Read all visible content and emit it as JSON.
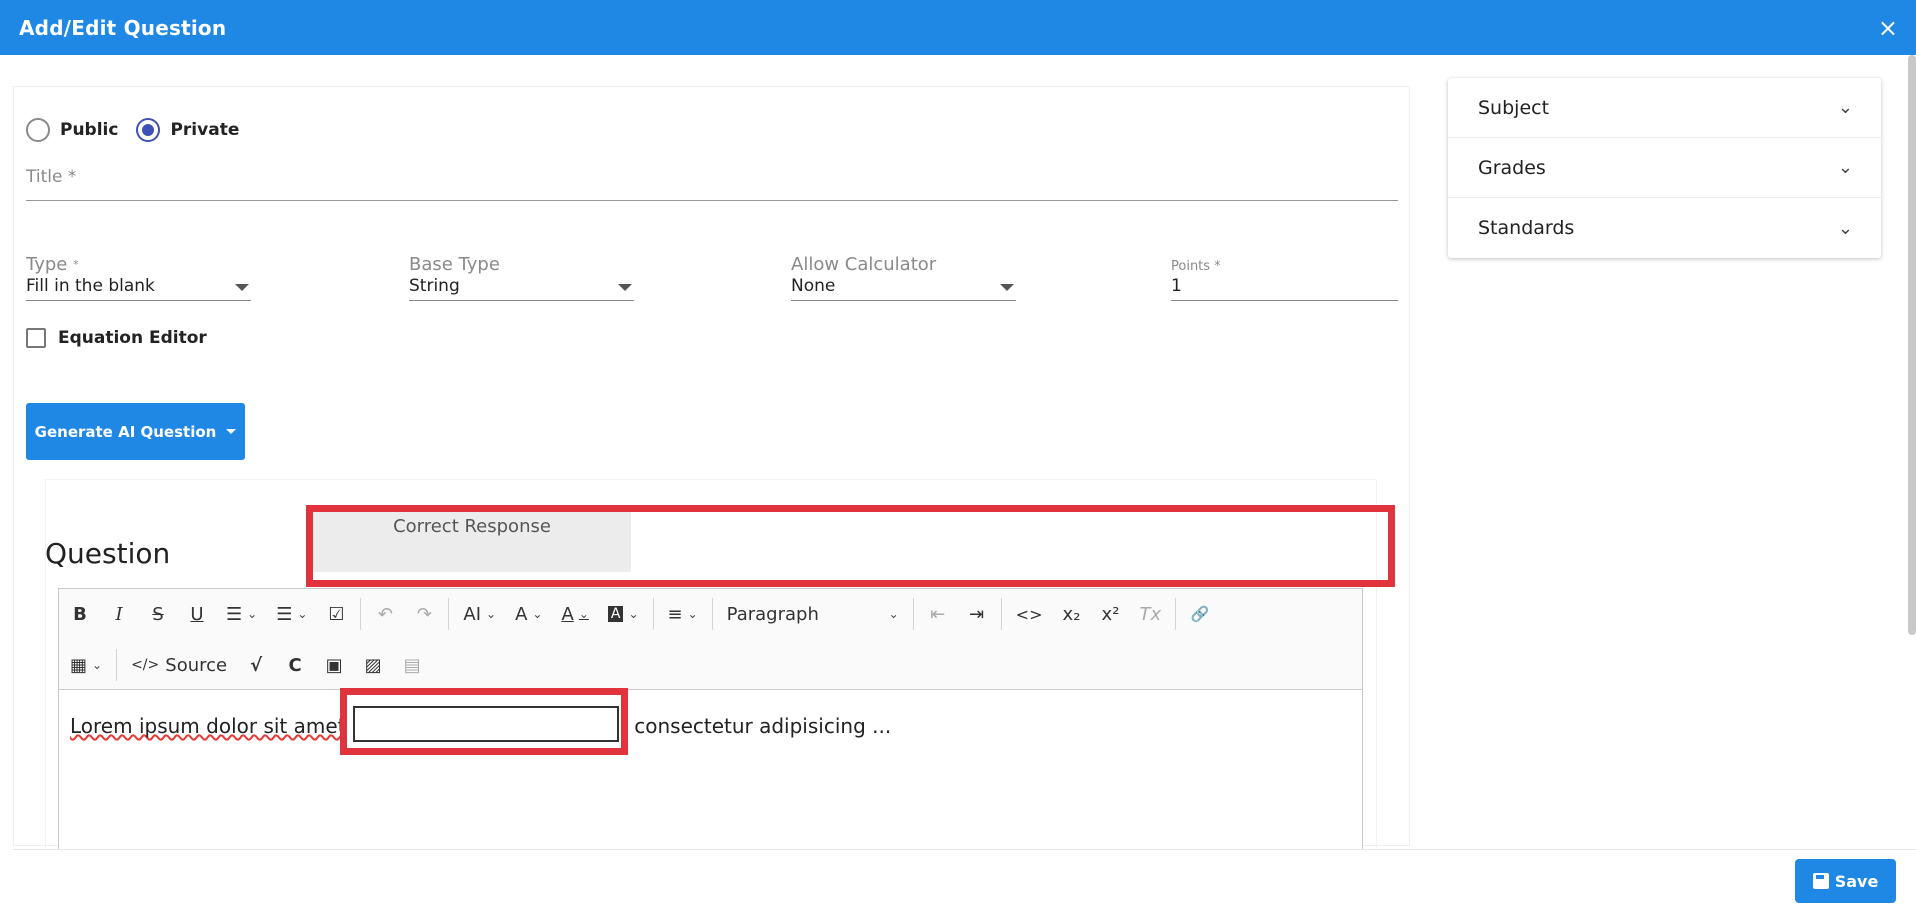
{
  "header": {
    "title": "Add/Edit Question",
    "close_icon": "×"
  },
  "visibility": {
    "public_label": "Public",
    "private_label": "Private",
    "selected": "Private"
  },
  "title_field": {
    "label": "Title *"
  },
  "fields": {
    "type": {
      "label": "Type",
      "required_mark": "*",
      "value": "Fill in the blank"
    },
    "base_type": {
      "label": "Base Type",
      "value": "String"
    },
    "allow_calculator": {
      "label": "Allow Calculator",
      "value": "None"
    },
    "points": {
      "label": "Points *",
      "value": "1"
    }
  },
  "equation_editor": {
    "label": "Equation Editor",
    "checked": false
  },
  "ai_button": {
    "label": "Generate AI Question"
  },
  "question": {
    "title": "Question",
    "correct_response_tab": "Correct Response",
    "text_before": "Lorem ipsum dolor sit amet",
    "text_after": "consectetur adipisicing ..."
  },
  "toolbar": {
    "row1": [
      {
        "name": "bold-icon",
        "glyph": "B"
      },
      {
        "name": "italic-icon",
        "glyph": "I"
      },
      {
        "name": "strikethrough-icon",
        "glyph": "S"
      },
      {
        "name": "underline-icon",
        "glyph": "U"
      },
      {
        "name": "bulleted-list-icon",
        "glyph": "☰"
      },
      {
        "name": "numbered-list-icon",
        "glyph": "☰"
      },
      {
        "name": "todo-list-icon",
        "glyph": "☑"
      },
      {
        "name": "undo-icon",
        "glyph": "↶"
      },
      {
        "name": "redo-icon",
        "glyph": "↷"
      },
      {
        "name": "font-size-icon",
        "glyph": "AI"
      },
      {
        "name": "font-family-icon",
        "glyph": "A"
      },
      {
        "name": "font-color-icon",
        "glyph": "A"
      },
      {
        "name": "font-background-icon",
        "glyph": "A"
      },
      {
        "name": "align-icon",
        "glyph": "≡"
      }
    ],
    "paragraph_label": "Paragraph",
    "row1_right": [
      {
        "name": "outdent-icon",
        "glyph": "⇤"
      },
      {
        "name": "indent-icon",
        "glyph": "⇥"
      },
      {
        "name": "code-icon",
        "glyph": "<>"
      },
      {
        "name": "subscript-icon",
        "glyph": "x₂"
      },
      {
        "name": "superscript-icon",
        "glyph": "x²"
      },
      {
        "name": "remove-format-icon",
        "glyph": "Tx"
      },
      {
        "name": "link-icon",
        "glyph": "🔗"
      }
    ],
    "source_label": "Source",
    "row2": [
      {
        "name": "table-icon",
        "glyph": "▦"
      },
      {
        "name": "math-icon",
        "glyph": "√"
      },
      {
        "name": "chemistry-icon",
        "glyph": "C"
      },
      {
        "name": "insert-media-icon",
        "glyph": "▣"
      },
      {
        "name": "insert-image-icon",
        "glyph": "▨"
      },
      {
        "name": "document-icon",
        "glyph": "▤"
      }
    ]
  },
  "sidebar": {
    "items": [
      {
        "label": "Subject"
      },
      {
        "label": "Grades"
      },
      {
        "label": "Standards"
      }
    ]
  },
  "footer": {
    "save_label": "Save"
  },
  "colors": {
    "accent": "#1f88e5",
    "highlight": "#e0333c",
    "radio": "#3f51b5"
  }
}
